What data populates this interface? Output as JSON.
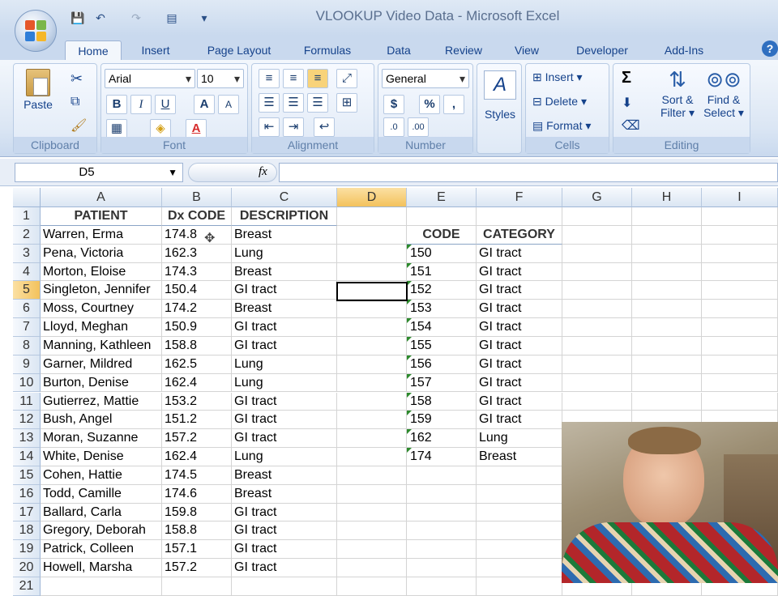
{
  "title": "VLOOKUP Video Data - Microsoft Excel",
  "tabs": [
    "Home",
    "Insert",
    "Page Layout",
    "Formulas",
    "Data",
    "Review",
    "View",
    "Developer",
    "Add-Ins"
  ],
  "ribbon": {
    "clipboard": {
      "label": "Clipboard",
      "paste": "Paste"
    },
    "font": {
      "label": "Font",
      "name": "Arial",
      "size": "10",
      "bold": "B",
      "italic": "I",
      "underline": "U",
      "grow": "A",
      "shrink": "A"
    },
    "alignment": {
      "label": "Alignment"
    },
    "number": {
      "label": "Number",
      "format": "General",
      "currency": "$",
      "percent": "%",
      "comma": ","
    },
    "styles": {
      "label": "Styles"
    },
    "cells": {
      "label": "Cells",
      "insert": "Insert",
      "delete": "Delete",
      "format": "Format"
    },
    "editing": {
      "label": "Editing",
      "sum": "Σ",
      "sort_line1": "Sort &",
      "sort_line2": "Filter",
      "find_line1": "Find &",
      "find_line2": "Select"
    }
  },
  "formula_bar": {
    "name_box": "D5",
    "fx": "fx",
    "value": ""
  },
  "columns": [
    "A",
    "B",
    "C",
    "D",
    "E",
    "F",
    "G",
    "H",
    "I"
  ],
  "selected_column": "D",
  "selected_row": "5",
  "rows": [
    {
      "n": "1",
      "A": "PATIENT",
      "B": "Dx CODE",
      "C": "DESCRIPTION",
      "E": "",
      "F": ""
    },
    {
      "n": "2",
      "A": "Warren, Erma",
      "B": "174.8",
      "C": "Breast",
      "E": "CODE",
      "F": "CATEGORY"
    },
    {
      "n": "3",
      "A": "Pena, Victoria",
      "B": "162.3",
      "C": "Lung",
      "E": "150",
      "F": "GI tract"
    },
    {
      "n": "4",
      "A": "Morton, Eloise",
      "B": "174.3",
      "C": "Breast",
      "E": "151",
      "F": "GI tract"
    },
    {
      "n": "5",
      "A": "Singleton, Jennifer",
      "B": "150.4",
      "C": "GI tract",
      "E": "152",
      "F": "GI tract"
    },
    {
      "n": "6",
      "A": "Moss, Courtney",
      "B": "174.2",
      "C": "Breast",
      "E": "153",
      "F": "GI tract"
    },
    {
      "n": "7",
      "A": "Lloyd, Meghan",
      "B": "150.9",
      "C": "GI tract",
      "E": "154",
      "F": "GI tract"
    },
    {
      "n": "8",
      "A": "Manning, Kathleen",
      "B": "158.8",
      "C": "GI tract",
      "E": "155",
      "F": "GI tract"
    },
    {
      "n": "9",
      "A": "Garner, Mildred",
      "B": "162.5",
      "C": "Lung",
      "E": "156",
      "F": "GI tract"
    },
    {
      "n": "10",
      "A": "Burton, Denise",
      "B": "162.4",
      "C": "Lung",
      "E": "157",
      "F": "GI tract"
    },
    {
      "n": "11",
      "A": "Gutierrez, Mattie",
      "B": "153.2",
      "C": "GI tract",
      "E": "158",
      "F": "GI tract"
    },
    {
      "n": "12",
      "A": "Bush, Angel",
      "B": "151.2",
      "C": "GI tract",
      "E": "159",
      "F": "GI tract"
    },
    {
      "n": "13",
      "A": "Moran, Suzanne",
      "B": "157.2",
      "C": "GI tract",
      "E": "162",
      "F": "Lung"
    },
    {
      "n": "14",
      "A": "White, Denise",
      "B": "162.4",
      "C": "Lung",
      "E": "174",
      "F": "Breast"
    },
    {
      "n": "15",
      "A": "Cohen, Hattie",
      "B": "174.5",
      "C": "Breast",
      "E": "",
      "F": ""
    },
    {
      "n": "16",
      "A": "Todd, Camille",
      "B": "174.6",
      "C": "Breast",
      "E": "",
      "F": ""
    },
    {
      "n": "17",
      "A": "Ballard, Carla",
      "B": "159.8",
      "C": "GI tract",
      "E": "",
      "F": ""
    },
    {
      "n": "18",
      "A": "Gregory, Deborah",
      "B": "158.8",
      "C": "GI tract",
      "E": "",
      "F": ""
    },
    {
      "n": "19",
      "A": "Patrick, Colleen",
      "B": "157.1",
      "C": "GI tract",
      "E": "",
      "F": ""
    },
    {
      "n": "20",
      "A": "Howell, Marsha",
      "B": "157.2",
      "C": "GI tract",
      "E": "",
      "F": ""
    },
    {
      "n": "21",
      "A": "",
      "B": "",
      "C": "",
      "E": "",
      "F": ""
    }
  ],
  "colors": {
    "ribbon": "#dbe6f4",
    "selected_header": "#f8c96a",
    "text_green_marker": "#2d8a2d"
  }
}
